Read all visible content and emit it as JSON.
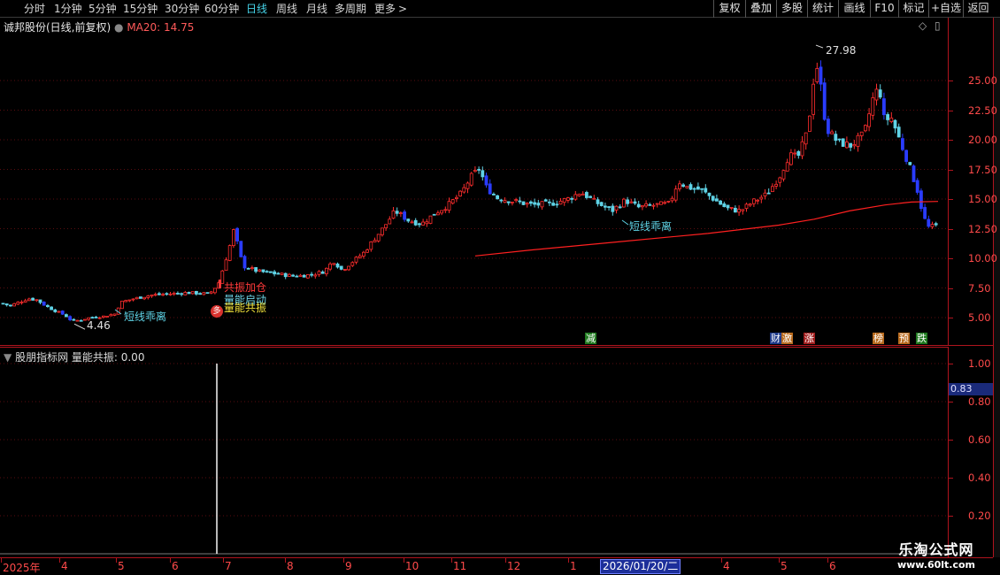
{
  "toolbar": {
    "periods": [
      "分时",
      "1分钟",
      "5分钟",
      "15分钟",
      "30分钟",
      "60分钟",
      "日线",
      "周线",
      "月线",
      "多周期",
      "更多"
    ],
    "active_period": "日线",
    "more_arrow": ">",
    "buttons": [
      "复权",
      "叠加",
      "多股",
      "统计",
      "画线",
      "F10",
      "标记",
      "+自选",
      "返回"
    ]
  },
  "main": {
    "stock_title": "诚邦股份(日线,前复权)",
    "ma_label": "MA20: 14.75",
    "high_label": "27.98",
    "low_label": "4.46",
    "annotations": [
      "短线乖离",
      "共振加仓",
      "量能启动",
      "量能共振",
      "短线乖离"
    ],
    "events": [
      {
        "text": "减",
        "color": "#1f7a1f"
      },
      {
        "text": "财",
        "color": "#1e3a8a"
      },
      {
        "text": "激",
        "color": "#b86a1d"
      },
      {
        "text": "涨",
        "color": "#a11e1e"
      },
      {
        "text": "榜",
        "color": "#b86a1d"
      },
      {
        "text": "预",
        "color": "#b86a1d"
      },
      {
        "text": "跌",
        "color": "#1f7a1f"
      }
    ],
    "badge_char": "多",
    "right_icons": [
      "◇",
      "▯"
    ]
  },
  "sub": {
    "title": "股朋指标网 量能共振: 0.00",
    "cursor_value": "0.83"
  },
  "dates": {
    "labels": [
      "2025年",
      "4",
      "5",
      "6",
      "7",
      "8",
      "9",
      "10",
      "11",
      "12",
      "1",
      "4",
      "5",
      "6"
    ],
    "cursor_date": "2026/01/20/二"
  },
  "watermark": {
    "title": "乐淘公式网",
    "url": "www.60lt.com"
  },
  "chart_data": [
    {
      "type": "candlestick",
      "title": "诚邦股份(日线,前复权)",
      "y_ticks": [
        5.0,
        7.5,
        10.0,
        12.5,
        15.0,
        17.5,
        20.0,
        22.5,
        25.0
      ],
      "ylim": [
        3.0,
        29.5
      ],
      "annotated_high": 27.98,
      "annotated_low": 4.46,
      "ma20_last": 14.75,
      "close_path": [
        [
          0,
          6.2
        ],
        [
          10,
          6.0
        ],
        [
          20,
          6.3
        ],
        [
          30,
          6.6
        ],
        [
          40,
          6.5
        ],
        [
          50,
          6.0
        ],
        [
          60,
          5.6
        ],
        [
          72,
          5.2
        ],
        [
          80,
          4.7
        ],
        [
          90,
          4.8
        ],
        [
          100,
          5.0
        ],
        [
          115,
          5.1
        ],
        [
          128,
          5.3
        ],
        [
          135,
          6.3
        ],
        [
          150,
          6.6
        ],
        [
          170,
          6.9
        ],
        [
          190,
          7.0
        ],
        [
          210,
          7.1
        ],
        [
          235,
          7.0
        ],
        [
          245,
          7.8
        ],
        [
          252,
          9.5
        ],
        [
          258,
          11.0
        ],
        [
          264,
          12.8
        ],
        [
          268,
          10.5
        ],
        [
          275,
          9.3
        ],
        [
          290,
          8.9
        ],
        [
          310,
          8.7
        ],
        [
          330,
          8.5
        ],
        [
          350,
          8.6
        ],
        [
          365,
          8.9
        ],
        [
          375,
          9.8
        ],
        [
          385,
          9.0
        ],
        [
          395,
          9.6
        ],
        [
          410,
          10.5
        ],
        [
          420,
          11.5
        ],
        [
          432,
          12.6
        ],
        [
          445,
          14.0
        ],
        [
          460,
          13.2
        ],
        [
          475,
          12.9
        ],
        [
          490,
          13.8
        ],
        [
          505,
          14.5
        ],
        [
          520,
          15.5
        ],
        [
          530,
          16.8
        ],
        [
          540,
          17.6
        ],
        [
          548,
          16.0
        ],
        [
          560,
          15.1
        ],
        [
          580,
          14.8
        ],
        [
          600,
          14.5
        ],
        [
          620,
          14.6
        ],
        [
          640,
          15.0
        ],
        [
          655,
          15.6
        ],
        [
          670,
          14.8
        ],
        [
          690,
          14.0
        ],
        [
          705,
          14.9
        ],
        [
          720,
          14.3
        ],
        [
          740,
          14.5
        ],
        [
          755,
          14.6
        ],
        [
          765,
          16.5
        ],
        [
          775,
          16.0
        ],
        [
          790,
          15.8
        ],
        [
          805,
          15.0
        ],
        [
          820,
          14.2
        ],
        [
          835,
          14.0
        ],
        [
          850,
          14.8
        ],
        [
          865,
          15.4
        ],
        [
          880,
          17.0
        ],
        [
          890,
          18.7
        ],
        [
          900,
          18.5
        ],
        [
          910,
          20.5
        ],
        [
          915,
          23.0
        ],
        [
          920,
          26.8
        ],
        [
          925,
          25.0
        ],
        [
          932,
          21.0
        ],
        [
          945,
          19.8
        ],
        [
          960,
          19.5
        ],
        [
          975,
          20.5
        ],
        [
          985,
          23.5
        ],
        [
          992,
          24.5
        ],
        [
          998,
          21.5
        ],
        [
          1005,
          22.0
        ],
        [
          1015,
          20.0
        ],
        [
          1025,
          18.0
        ],
        [
          1035,
          15.8
        ],
        [
          1042,
          13.5
        ],
        [
          1048,
          12.6
        ],
        [
          1060,
          12.8
        ]
      ]
    },
    {
      "type": "line",
      "title": "量能共振",
      "y_ticks": [
        0.2,
        0.4,
        0.6,
        0.8,
        1.0
      ],
      "ylim": [
        0.0,
        1.05
      ],
      "spike": {
        "x_date": "2025/06 end",
        "value": 1.0
      },
      "current_value": 0.0
    }
  ]
}
